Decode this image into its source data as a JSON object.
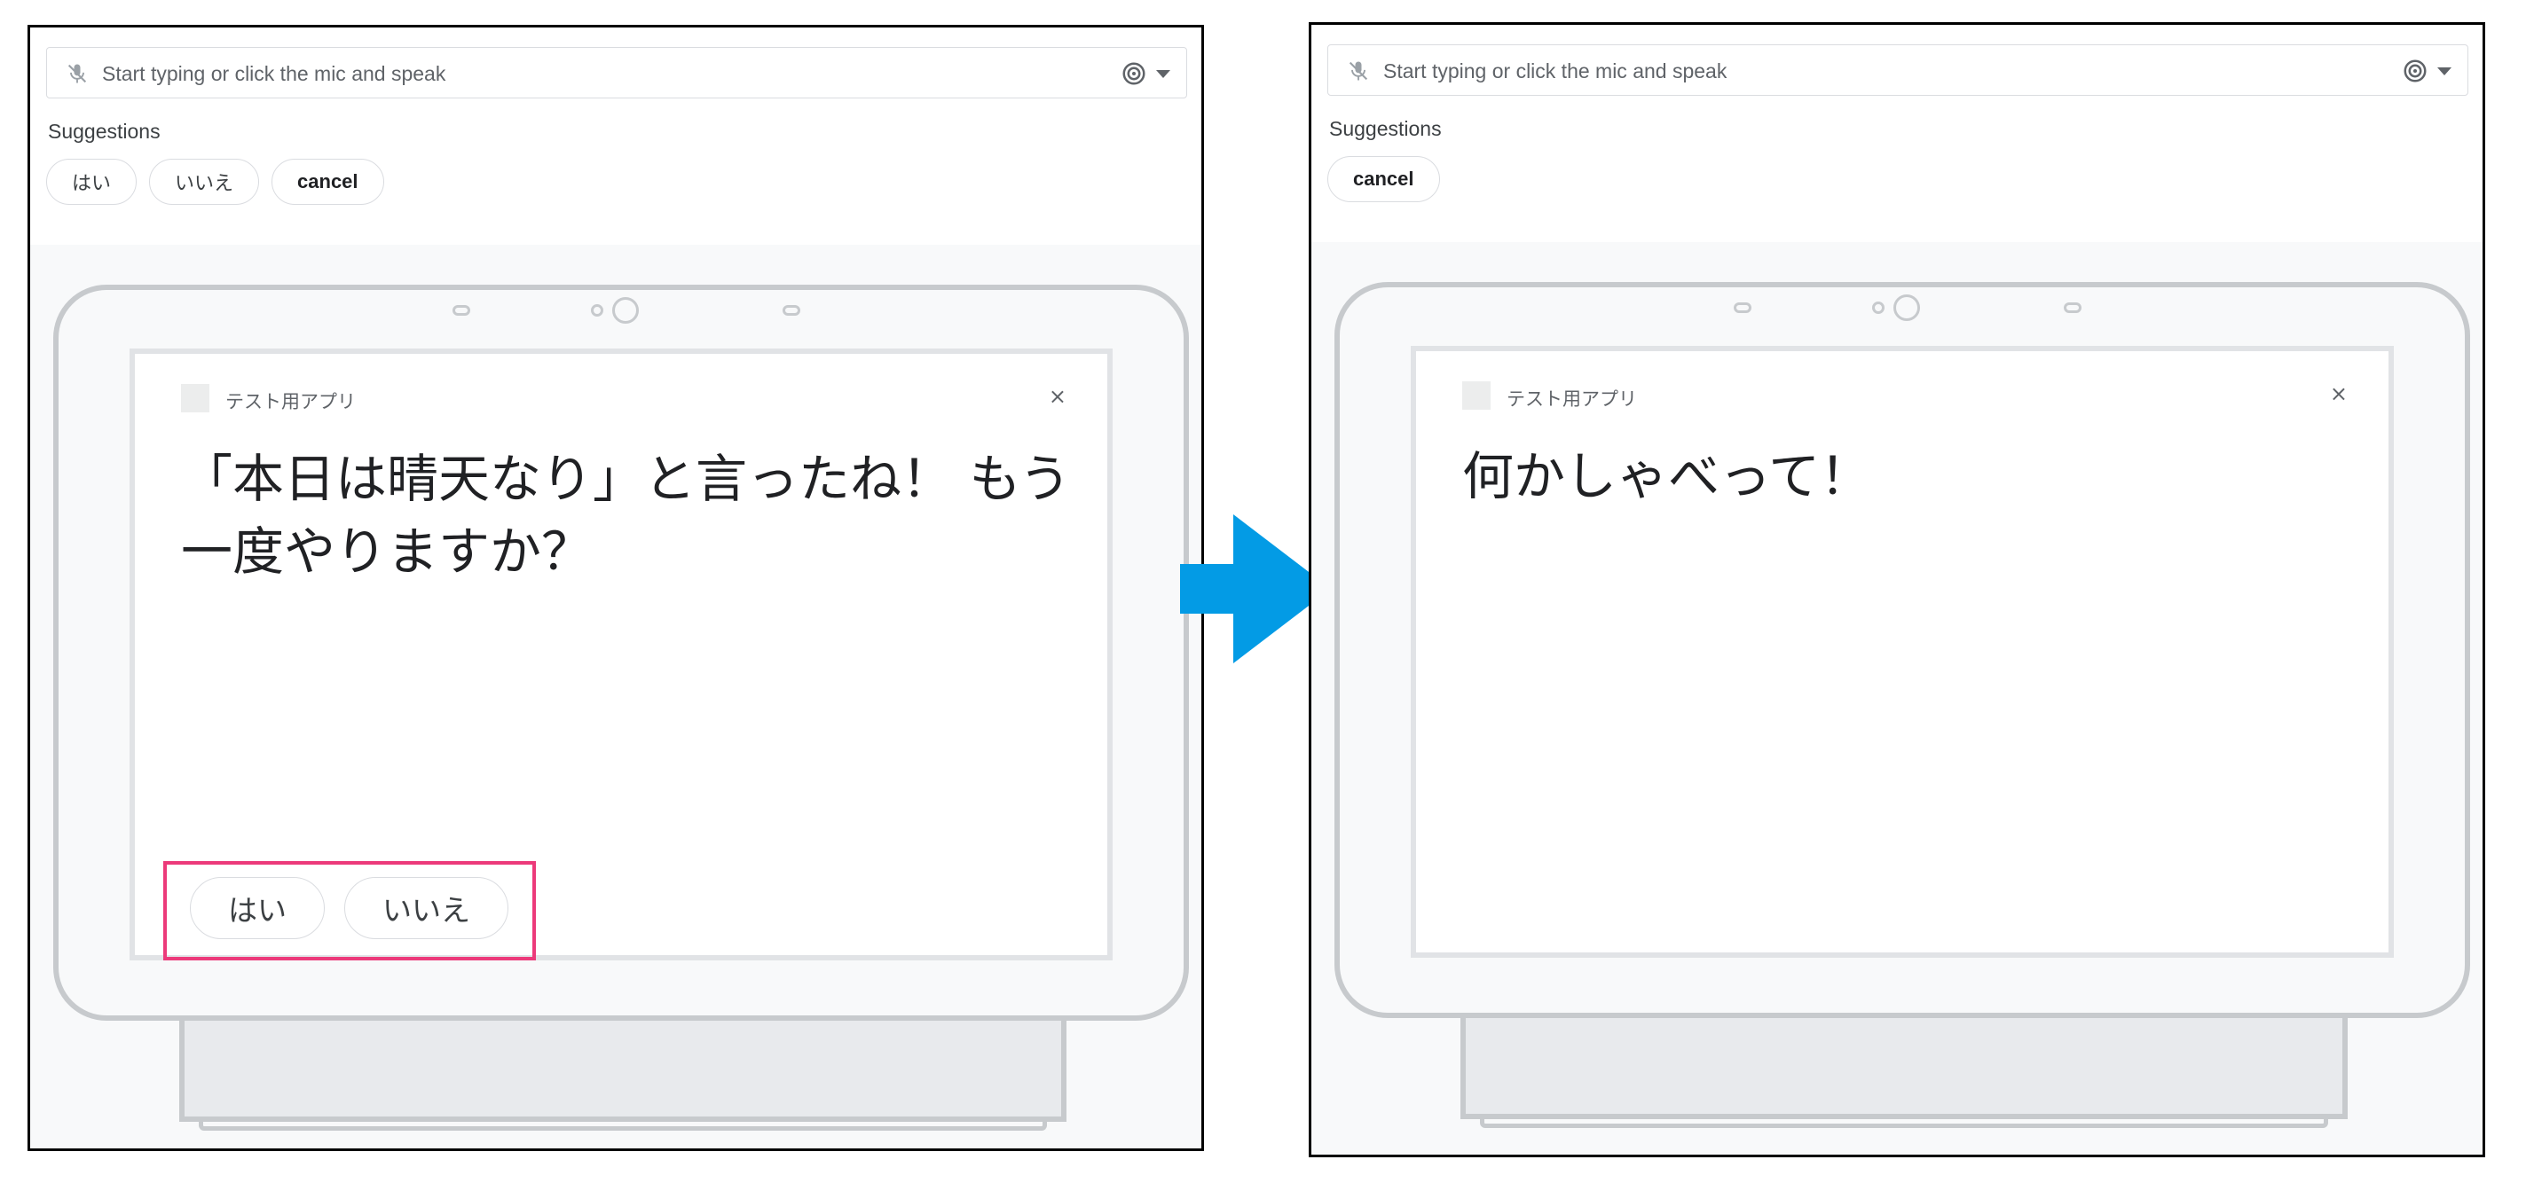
{
  "left": {
    "input_placeholder": "Start typing or click the mic and speak",
    "suggestions_label": "Suggestions",
    "suggestions": [
      "はい",
      "いいえ",
      "cancel"
    ],
    "app_name": "テスト用アプリ",
    "close_symbol": "×",
    "message": "「本日は晴天なり」と言ったね！ もう一度やりますか？",
    "screen_chips": [
      "はい",
      "いいえ"
    ]
  },
  "right": {
    "input_placeholder": "Start typing or click the mic and speak",
    "suggestions_label": "Suggestions",
    "suggestions": [
      "cancel"
    ],
    "app_name": "テスト用アプリ",
    "close_symbol": "×",
    "message": "何かしゃべって！"
  },
  "colors": {
    "arrow": "#039be5",
    "highlight_box": "#ec3a7a",
    "device_frame": "#c7cacd"
  },
  "icons": [
    "mic-off-icon",
    "assistant-icon",
    "dropdown-caret-icon",
    "app-icon",
    "close-icon",
    "right-arrow-icon"
  ]
}
